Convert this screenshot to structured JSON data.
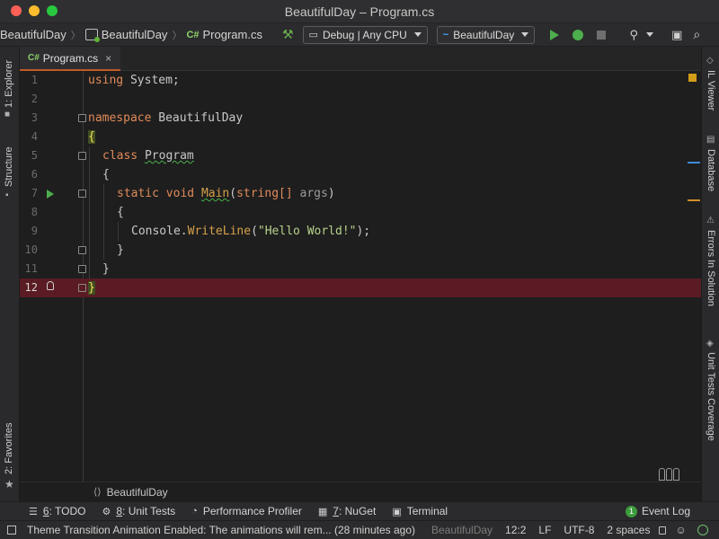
{
  "window": {
    "title": "BeautifulDay – Program.cs"
  },
  "navbar": {
    "crumbs": [
      "BeautifulDay",
      "BeautifulDay",
      "Program.cs"
    ],
    "file_prefix": "C#",
    "config_dropdown": "Debug | Any CPU",
    "run_target_dropdown": "BeautifulDay"
  },
  "tabs": [
    {
      "prefix": "C#",
      "label": "Program.cs",
      "close": "×"
    }
  ],
  "left_panel": {
    "explorer": "1: Explorer",
    "structure": "Structure",
    "favorites": "2: Favorites"
  },
  "right_panel": {
    "il_viewer": "IL Viewer",
    "database": "Database",
    "errors": "Errors In Solution",
    "coverage": "Unit Tests Coverage"
  },
  "editor": {
    "line_numbers": [
      "1",
      "2",
      "3",
      "4",
      "5",
      "6",
      "7",
      "8",
      "9",
      "10",
      "11",
      "12"
    ],
    "current_line": 12,
    "code": {
      "l1_kw": "using",
      "l1_rest": " System;",
      "l3_kw": "namespace",
      "l3_rest": " BeautifulDay",
      "l4": "{",
      "l5_kw": "class",
      "l5_name": "Program",
      "l6": "{",
      "l7_kw1": "static",
      "l7_kw2": "void",
      "l7_fn": "Main",
      "l7_paren": "(",
      "l7_type": "string[]",
      "l7_param": "args",
      "l7_close": ")",
      "l8": "{",
      "l9_obj": "Console.",
      "l9_fn": "WriteLine",
      "l9_open": "(",
      "l9_str": "\"Hello World!\"",
      "l9_close": ");",
      "l10": "}",
      "l11": "}",
      "l12": "}"
    },
    "footer_breadcrumb": "BeautifulDay"
  },
  "tool_windows": [
    {
      "num": "6",
      "rest": ": TODO"
    },
    {
      "num": "8",
      "rest": ": Unit Tests"
    },
    {
      "num": "",
      "rest": "Performance Profiler"
    },
    {
      "num": "7",
      "rest": ": NuGet"
    },
    {
      "num": "",
      "rest": "Terminal"
    }
  ],
  "event_log": {
    "count": "1",
    "label": "Event Log"
  },
  "status": {
    "message": "Theme Transition Animation Enabled: The animations will rem... (28 minutes ago)",
    "context": "BeautifulDay",
    "position": "12:2",
    "line_sep": "LF",
    "encoding": "UTF-8",
    "indent": "2 spaces"
  },
  "colors": {
    "accent_tab": "#bd5b2b",
    "current_line": "#5a1b24",
    "run_green": "#4cae4c"
  }
}
